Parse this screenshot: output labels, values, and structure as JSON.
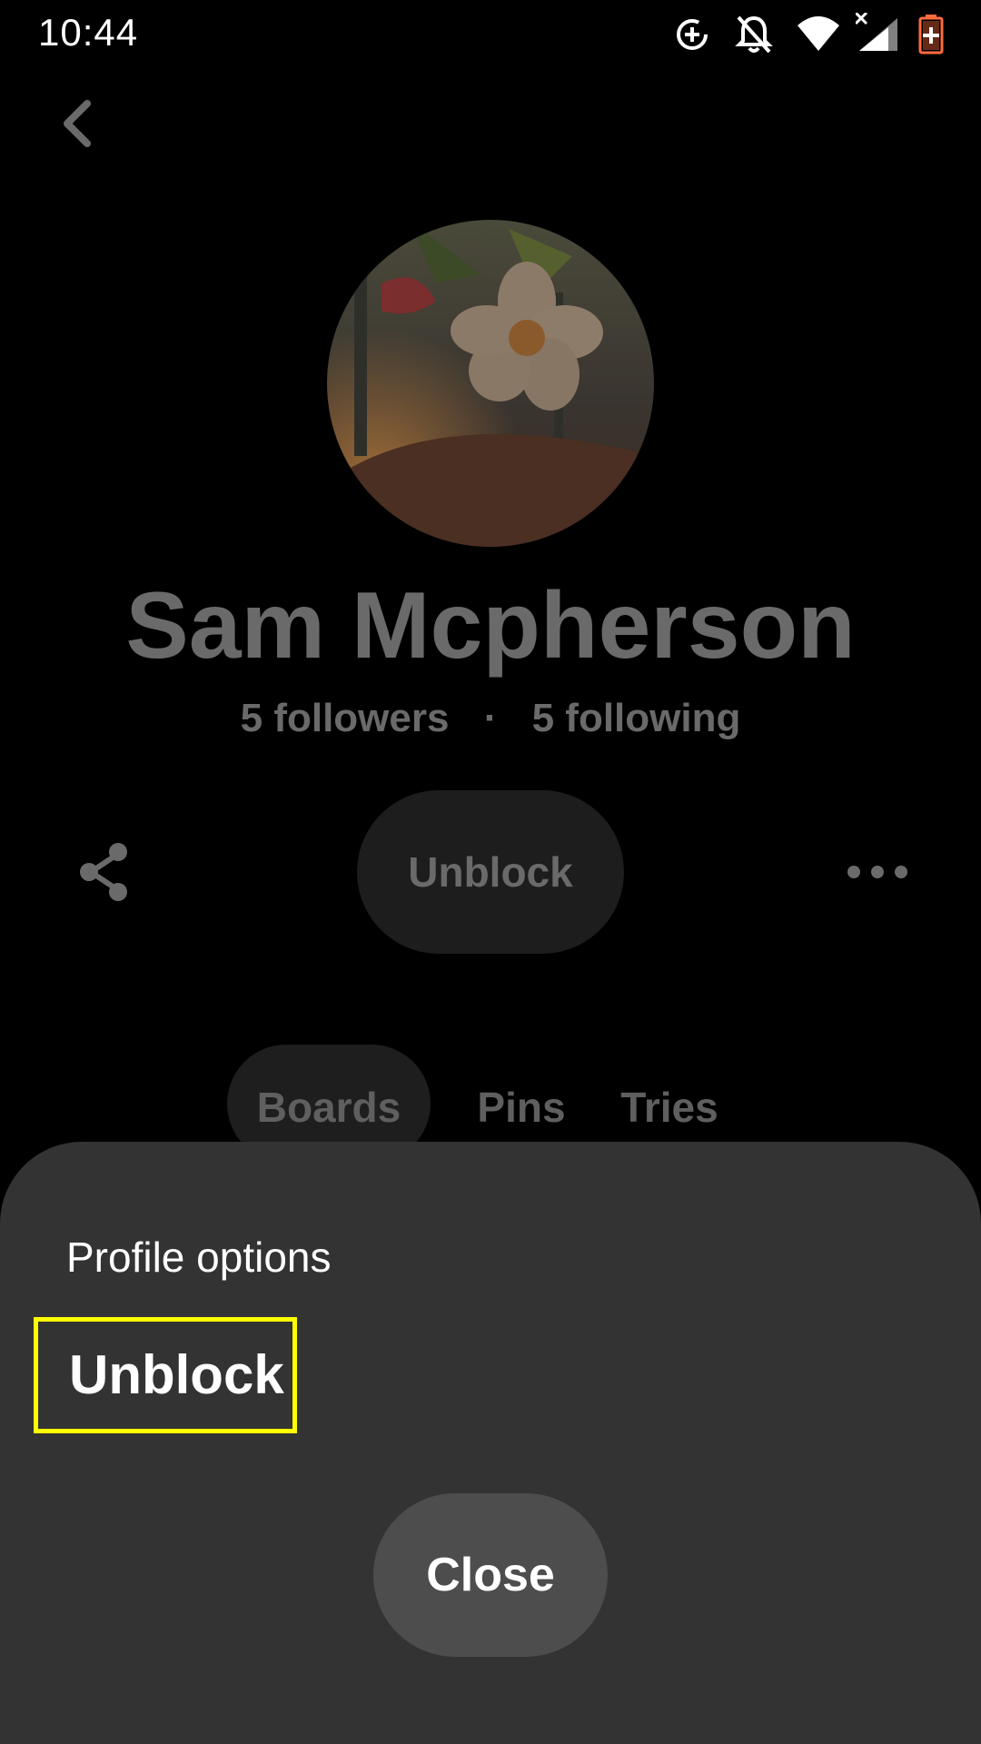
{
  "status_bar": {
    "time": "10:44",
    "icons": [
      "data-saver-icon",
      "notifications-off-icon",
      "wifi-icon",
      "cellular-signal-icon",
      "battery-charging-icon"
    ]
  },
  "profile": {
    "name": "Sam Mcpherson",
    "followers": "5 followers",
    "separator": "·",
    "following": "5 following",
    "primary_action": "Unblock",
    "tabs": [
      {
        "label": "Boards",
        "selected": true
      },
      {
        "label": "Pins",
        "selected": false
      },
      {
        "label": "Tries",
        "selected": false
      }
    ]
  },
  "sheet": {
    "title": "Profile options",
    "unblock_label": "Unblock",
    "close_label": "Close"
  },
  "colors": {
    "background": "#000000",
    "sheet": "#333333",
    "highlight": "#ffff00",
    "dimmed_text": "#6a6a6a"
  }
}
